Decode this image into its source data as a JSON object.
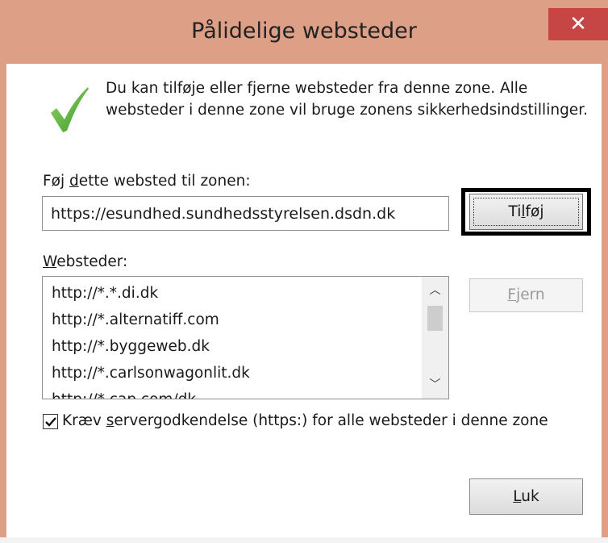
{
  "window": {
    "title": "Pålidelige websteder",
    "close_glyph": "✕"
  },
  "intro_text": "Du kan tilføje eller fjerne websteder fra denne zone. Alle websteder i denne zone vil bruge zonens sikkerhedsindstillinger.",
  "icons": {
    "status": "checkmark-icon",
    "status_color": "#5db13a"
  },
  "add_section": {
    "label_prefix": "Føj ",
    "label_accel": "d",
    "label_suffix": "ette websted til zonen:",
    "input_value": "https://esundhed.sundhedsstyrelsen.dsdn.dk",
    "add_button_prefix": "Ti",
    "add_button_accel": "l",
    "add_button_suffix": "føj"
  },
  "sites_section": {
    "label_accel": "W",
    "label_rest": "ebsteder:",
    "items": [
      "http://*.*.di.dk",
      "http://*.alternatiff.com",
      "http://*.byggeweb.dk",
      "http://*.carlsonwagonlit.dk",
      "http://*.cap.com/dk"
    ],
    "remove_button_accel": "F",
    "remove_button_rest": "jern",
    "scroll_up_glyph": "︿",
    "scroll_down_glyph": "﹀"
  },
  "https_option": {
    "checked": true,
    "label_prefix": "Kræv ",
    "label_accel": "s",
    "label_suffix": "ervergodkendelse (https:) for alle websteder i denne zone"
  },
  "footer": {
    "close_button_accel": "L",
    "close_button_rest": "uk"
  }
}
